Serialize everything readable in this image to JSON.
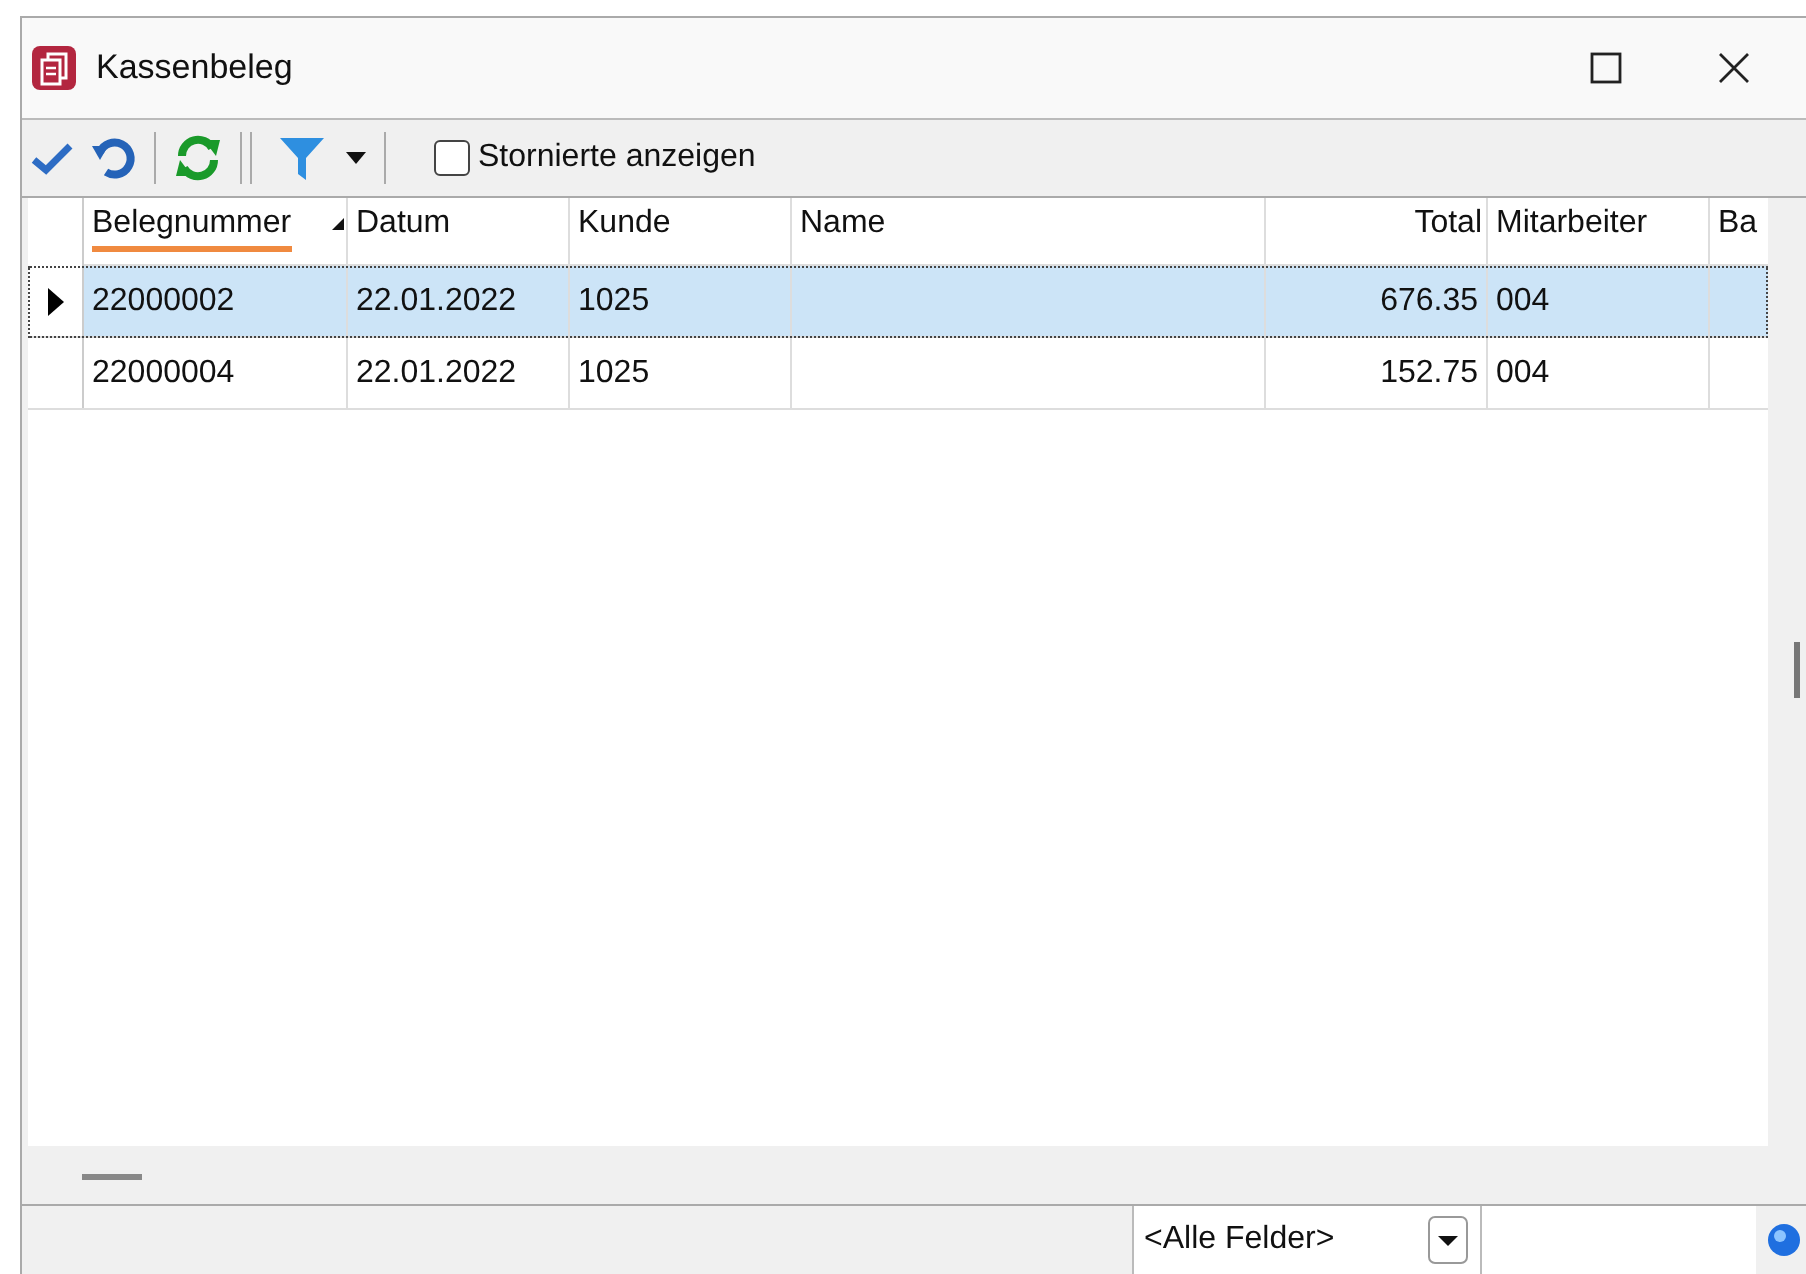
{
  "window": {
    "title": "Kassenbeleg"
  },
  "toolbar": {
    "show_cancelled": {
      "label": "Stornierte anzeigen",
      "checked": false
    }
  },
  "table": {
    "columns": [
      {
        "label": "Belegnummer",
        "sorted": true,
        "kind": "text"
      },
      {
        "label": "Datum",
        "sorted": false,
        "kind": "text"
      },
      {
        "label": "Kunde",
        "sorted": false,
        "kind": "text"
      },
      {
        "label": "Name",
        "sorted": false,
        "kind": "text"
      },
      {
        "label": "Total",
        "sorted": false,
        "kind": "number"
      },
      {
        "label": "Mitarbeiter",
        "sorted": false,
        "kind": "text"
      },
      {
        "label": "Ba",
        "sorted": false,
        "kind": "text"
      }
    ],
    "rows": [
      {
        "selected": true,
        "cells": [
          "22000002",
          "22.01.2022",
          "1025",
          "",
          "676.35",
          "004",
          ""
        ]
      },
      {
        "selected": false,
        "cells": [
          "22000004",
          "22.01.2022",
          "1025",
          "",
          "152.75",
          "004",
          ""
        ]
      }
    ]
  },
  "search_bar": {
    "field_selector": "<Alle Felder>"
  }
}
